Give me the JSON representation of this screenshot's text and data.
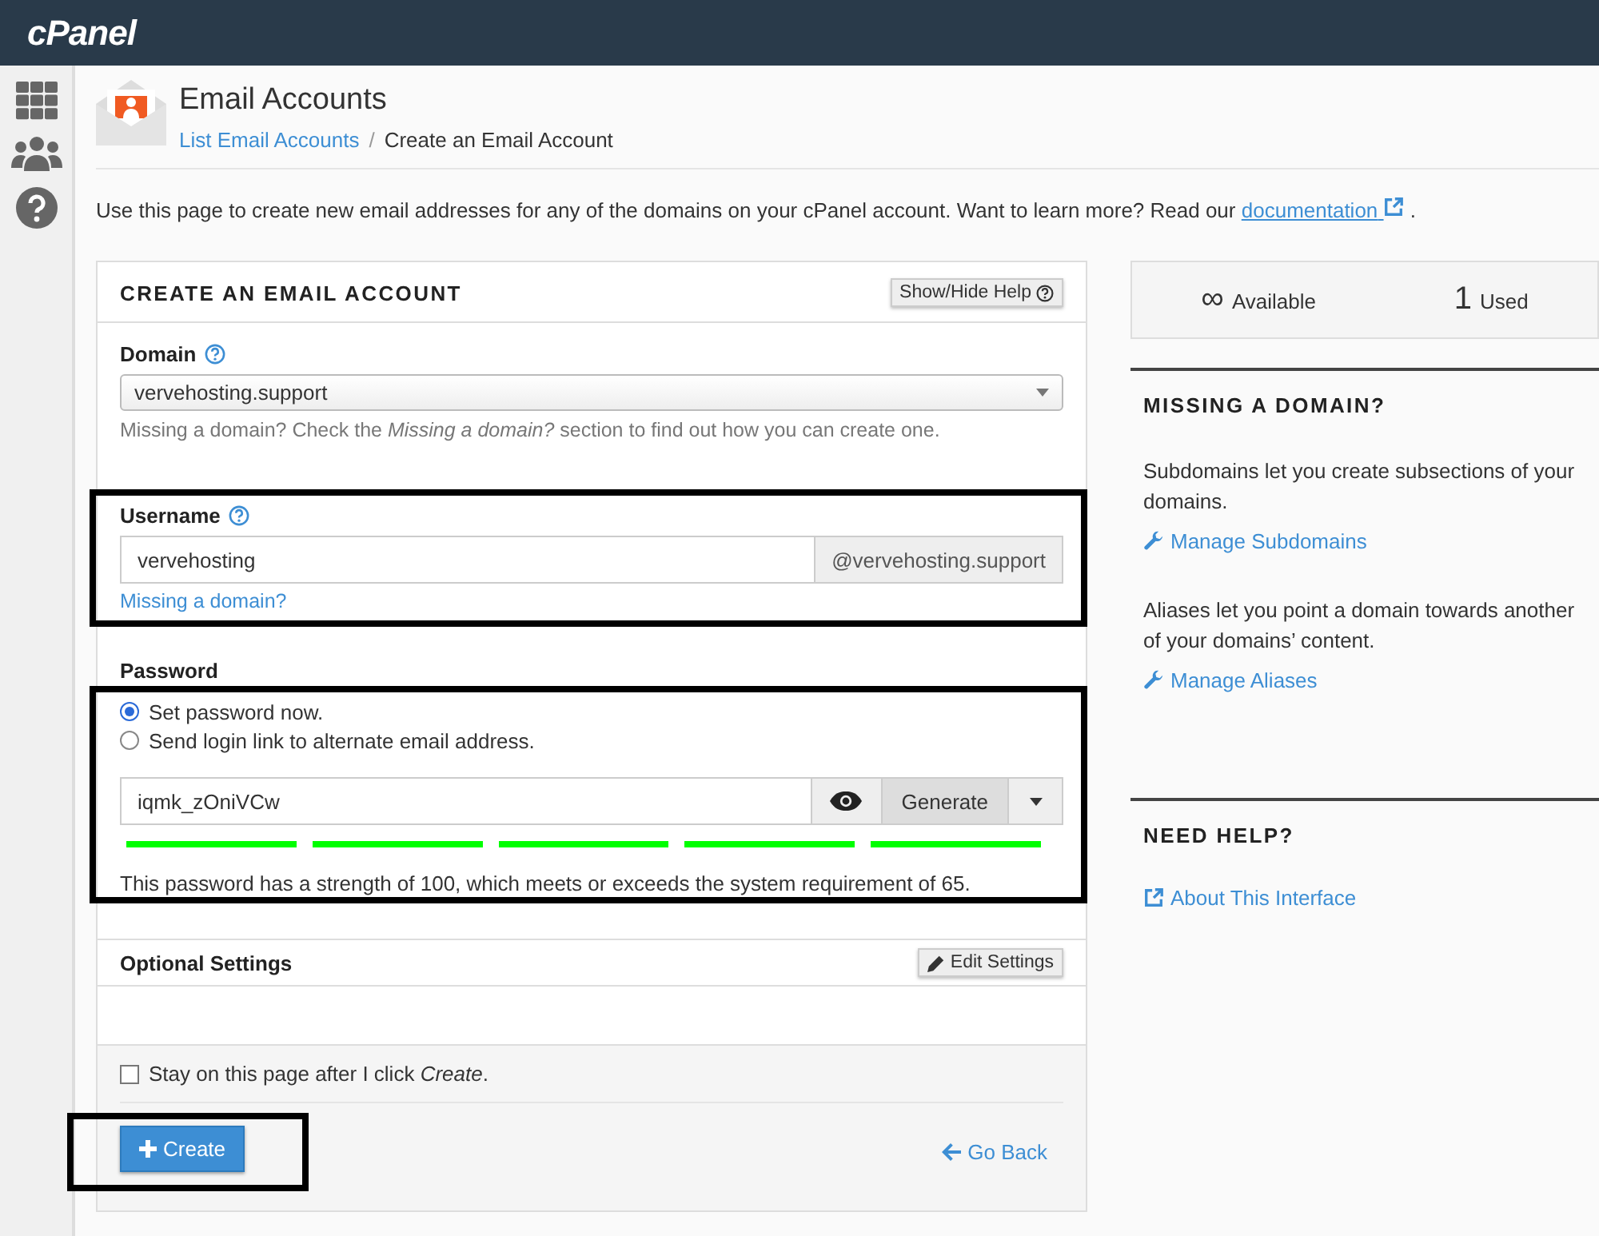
{
  "header": {
    "logo": "cPanel"
  },
  "page": {
    "title": "Email Accounts",
    "breadcrumb_separator": "/",
    "breadcrumb": [
      {
        "label": "List Email Accounts",
        "kind": "link"
      },
      {
        "label": "Create an Email Account",
        "kind": "current"
      }
    ],
    "intro": "Use this page to create new email addresses for any of the domains on your cPanel account. Want to learn more? Read our",
    "intro_link": "documentation",
    "intro_end": "."
  },
  "form": {
    "title": "CREATE AN EMAIL ACCOUNT",
    "help_button": "Show/Hide Help",
    "domain": {
      "label": "Domain",
      "value": "vervehosting.support",
      "hint": "Missing a domain? Check the *Missing a domain?* section to find out how you can create one."
    },
    "username": {
      "label": "Username",
      "value": "vervehosting",
      "suffix": "@vervehosting.support",
      "link": "Missing a domain?",
      "highlighted": true
    },
    "password": {
      "label": "Password",
      "highlighted": true,
      "options": [
        {
          "label": "Set password now.",
          "selected": true
        },
        {
          "label": "Send login link to alternate email address.",
          "selected": false
        }
      ],
      "value": "iqmk_zOniVCw",
      "generate": "Generate",
      "level": 1,
      "strength_text": "This password has a strength of 100, which meets or exceeds the system requirement of 65."
    },
    "optional": {
      "title": "Optional Settings",
      "button": "Edit Settings"
    },
    "stay": {
      "label": "Stay on this page after I click *Create*.",
      "checked": false
    },
    "create": {
      "label": "Create",
      "highlighted": true
    },
    "back": "Go Back"
  },
  "stats": [
    {
      "value": "∞",
      "label": "Available"
    },
    {
      "value": "1",
      "label": "Used"
    }
  ],
  "sections": [
    {
      "title": "MISSING A DOMAIN?",
      "blocks": [
        {
          "text": "Subdomains let you create subsections of your domains.",
          "link": "Manage Subdomains",
          "kind": "wrench"
        },
        {
          "text": "Aliases let you point a domain towards another of your domains’ content.",
          "link": "Manage Aliases",
          "kind": "wrench"
        }
      ]
    },
    {
      "title": "NEED HELP?",
      "blocks": [
        {
          "link": "About This Interface",
          "kind": "external"
        }
      ]
    }
  ]
}
